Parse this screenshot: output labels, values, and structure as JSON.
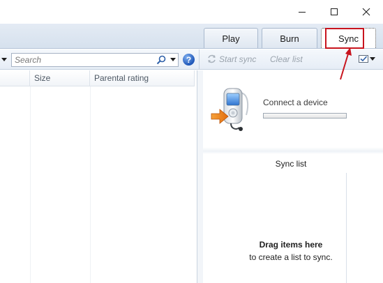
{
  "tabs": {
    "play": "Play",
    "burn": "Burn",
    "sync": "Sync"
  },
  "toolbar": {
    "search_placeholder": "Search",
    "help": "?",
    "start_sync": "Start sync",
    "clear_list": "Clear list"
  },
  "columns": {
    "size": "Size",
    "parental_rating": "Parental rating"
  },
  "device": {
    "connect_label": "Connect a device",
    "progress": 0
  },
  "sync_list": {
    "title": "Sync list",
    "empty_title": "Drag items here",
    "empty_subtitle": "to create a list to sync."
  },
  "icons": {
    "minimize": "minimize-icon",
    "maximize": "maximize-icon",
    "close": "close-icon",
    "search": "search-icon",
    "help": "help-icon",
    "start_sync": "sync-arrows-icon",
    "sync_options": "sync-options-icon",
    "device": "portable-device-icon"
  },
  "colors": {
    "highlight": "#c8141e",
    "accent": "#1f57b8"
  }
}
